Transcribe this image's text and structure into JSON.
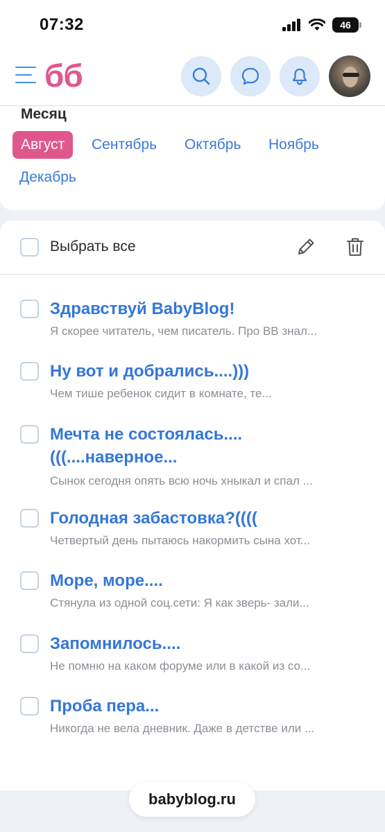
{
  "status_bar": {
    "time": "07:32",
    "battery": "46"
  },
  "header": {
    "logo": "бб",
    "icons": [
      "menu-icon",
      "search-icon",
      "chat-icon",
      "bell-icon"
    ]
  },
  "month_filter": {
    "title": "Месяц",
    "months": [
      "Август",
      "Сентябрь",
      "Октябрь",
      "Ноябрь",
      "Декабрь"
    ],
    "selected": "Август"
  },
  "toolbar": {
    "select_all": "Выбрать все"
  },
  "entries": [
    {
      "title": "Здравствуй BabyBlog!",
      "excerpt": "Я скорее читатель, чем писатель. Про BB знал..."
    },
    {
      "title": "Ну вот и добрались....)))",
      "excerpt": "Чем тише ребенок сидит в комнате, те..."
    },
    {
      "title": "Мечта не состоялась.... (((....наверное...",
      "excerpt": "Сынок сегодня опять всю ночь хныкал и спал ..."
    },
    {
      "title": "Голодная забастовка?((((",
      "excerpt": "Четвертый день пытаюсь накормить сына хот..."
    },
    {
      "title": "Море, море....",
      "excerpt": "Стянула из одной соц.сети: Я как зверь- зали..."
    },
    {
      "title": "Запомнилось....",
      "excerpt": "Не помню на каком форуме или в какой из со..."
    },
    {
      "title": "Проба пера...",
      "excerpt": "Никогда не вела дневник. Даже в детстве или ..."
    }
  ],
  "browser": {
    "url": "babyblog.ru"
  },
  "colors": {
    "brand_pink": "#e0578d",
    "link_blue": "#3477d6",
    "icon_bg": "#dbe9f8"
  }
}
